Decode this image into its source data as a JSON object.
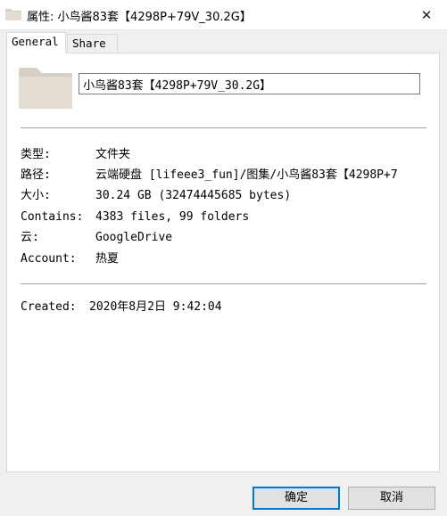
{
  "window": {
    "title": "属性: 小鸟酱83套【4298P+79V_30.2G】",
    "close_glyph": "✕"
  },
  "tabs": [
    {
      "label": "General",
      "active": true
    },
    {
      "label": "Share",
      "active": false
    }
  ],
  "general": {
    "name_value": "小鸟酱83套【4298P+79V_30.2G】",
    "properties": [
      {
        "key": "类型:",
        "value": "文件夹"
      },
      {
        "key": "路径:",
        "value": "云端硬盘 [lifeee3_fun]/图集/小鸟酱83套【4298P+7"
      },
      {
        "key": "大小:",
        "value": "30.24 GB (32474445685 bytes)"
      },
      {
        "key": "Contains:",
        "value": "4383 files, 99 folders"
      },
      {
        "key": "云:",
        "value": "GoogleDrive"
      },
      {
        "key": "Account:",
        "value": "热夏"
      }
    ],
    "created": {
      "key": "Created:",
      "value": "2020年8月2日 9:42:04"
    }
  },
  "buttons": {
    "ok_label": "确定",
    "cancel_label": "取消"
  },
  "colors": {
    "folder": "#e3ddd3",
    "folder_dark": "#d6cfc3",
    "accent": "#0078d7"
  }
}
